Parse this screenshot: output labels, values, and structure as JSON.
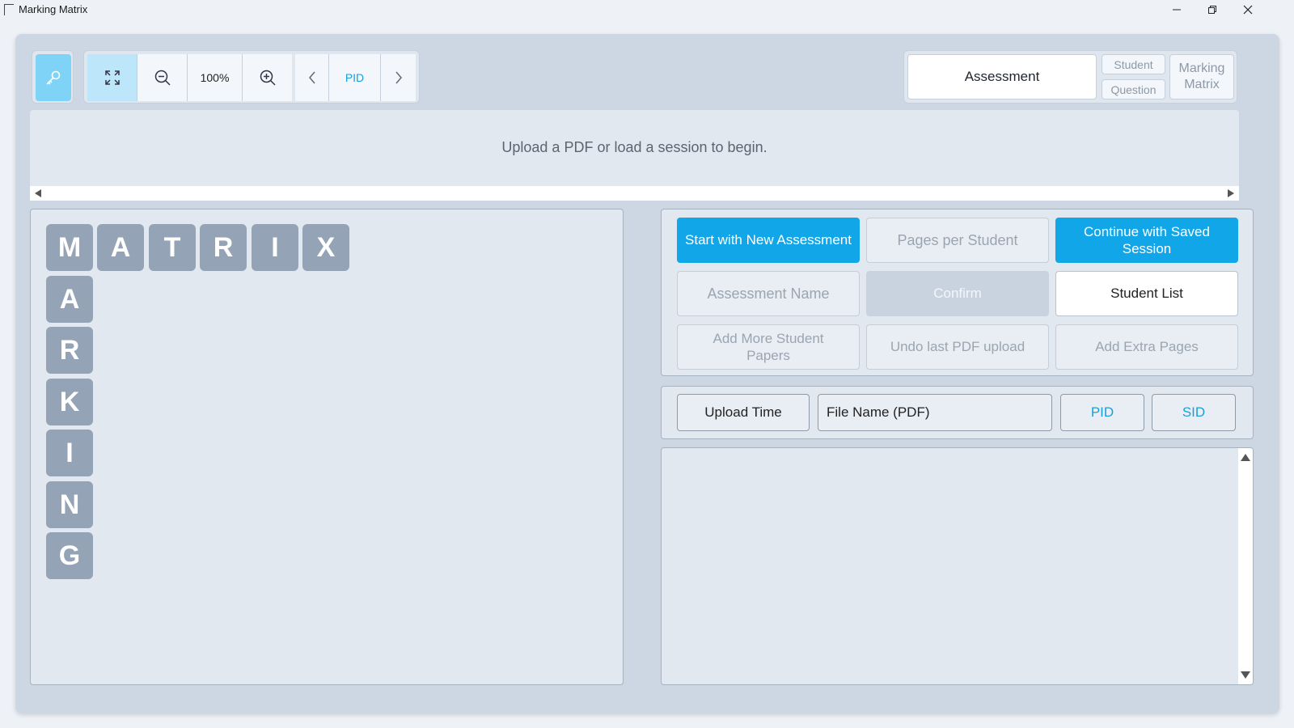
{
  "window": {
    "title": "Marking Matrix",
    "icon": "app-window-icon"
  },
  "toolbar": {
    "key_icon": "key-icon",
    "fit_icon": "fit-to-screen-icon",
    "zoom_out_icon": "zoom-out-icon",
    "zoom_level": "100%",
    "zoom_in_icon": "zoom-in-icon",
    "prev_icon": "chevron-left-icon",
    "page_label": "PID",
    "next_icon": "chevron-right-icon"
  },
  "modes": {
    "assessment": "Assessment",
    "student": "Student",
    "question": "Question",
    "marking_matrix": "Marking\nMatrix"
  },
  "viewer": {
    "message": "Upload a PDF or load a session to begin."
  },
  "logo": {
    "row": [
      "M",
      "A",
      "T",
      "R",
      "I",
      "X"
    ],
    "column": [
      "A",
      "R",
      "K",
      "I",
      "N",
      "G"
    ]
  },
  "actions": {
    "start_new": "Start with New Assessment",
    "pages_per_student": "Pages per Student",
    "continue_saved": "Continue with Saved Session",
    "assessment_name": "Assessment Name",
    "confirm": "Confirm",
    "student_list": "Student List",
    "add_more_papers": "Add More Student Papers",
    "undo_upload": "Undo last PDF upload",
    "add_extra_pages": "Add Extra Pages"
  },
  "filters": {
    "upload_time": "Upload Time",
    "file_name": "File Name (PDF)",
    "pid": "PID",
    "sid": "SID"
  },
  "colors": {
    "accent": "#10a6e8",
    "accent_light": "#7fd3f7",
    "tile": "#95a3b6",
    "panel": "#e1e8f0",
    "frame": "#cdd7e3"
  }
}
